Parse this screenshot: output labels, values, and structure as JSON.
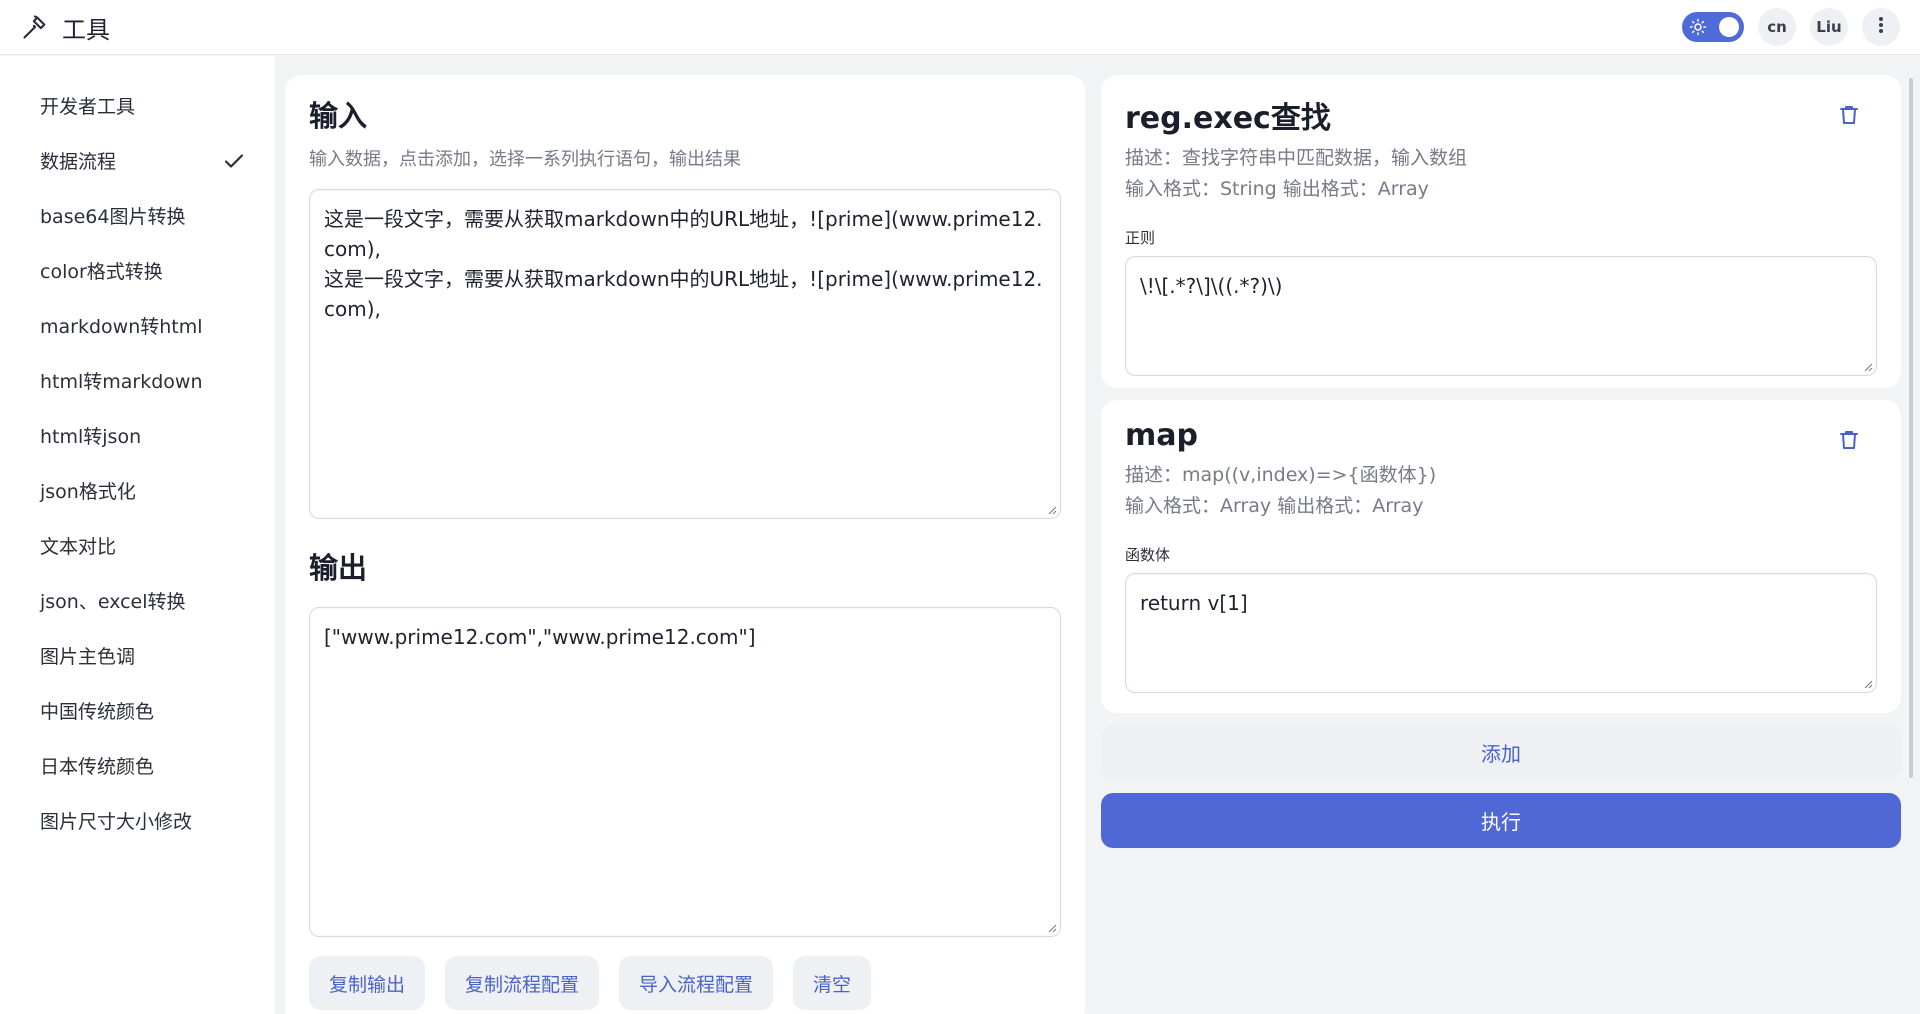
{
  "app": {
    "title": "工具"
  },
  "header": {
    "lang_label": "cn",
    "user_label": "Liu"
  },
  "sidebar": {
    "items": [
      {
        "label": "开发者工具"
      },
      {
        "label": "数据流程"
      },
      {
        "label": "base64图片转换"
      },
      {
        "label": "color格式转换"
      },
      {
        "label": "markdown转html"
      },
      {
        "label": "html转markdown"
      },
      {
        "label": "html转json"
      },
      {
        "label": "json格式化"
      },
      {
        "label": "文本对比"
      },
      {
        "label": "json、excel转换"
      },
      {
        "label": "图片主色调"
      },
      {
        "label": "中国传统颜色"
      },
      {
        "label": "日本传统颜色"
      },
      {
        "label": "图片尺寸大小修改"
      }
    ],
    "selected_index": 1
  },
  "input_section": {
    "title": "输入",
    "description": "输入数据，点击添加，选择一系列执行语句，输出结果",
    "value": "这是一段文字，需要从获取markdown中的URL地址，![prime](www.prime12.com),\n这是一段文字，需要从获取markdown中的URL地址，![prime](www.prime12.com),"
  },
  "output_section": {
    "title": "输出",
    "value": "[\"www.prime12.com\",\"www.prime12.com\"]"
  },
  "action_buttons": {
    "copy_output": "复制输出",
    "copy_config": "复制流程配置",
    "import_config": "导入流程配置",
    "clear": "清空"
  },
  "steps": [
    {
      "title": "reg.exec查找",
      "description": "描述：查找字符串中匹配数据，输入数组",
      "formats": "输入格式：String 输出格式：Array",
      "field_label": "正则",
      "field_value": "\\!\\[.*?\\]\\((.*?)\\)"
    },
    {
      "title": "map",
      "description": "描述：map((v,index)=>{函数体})",
      "formats": "输入格式：Array 输出格式：Array",
      "field_label": "函数体",
      "field_value": "return v[1]"
    }
  ],
  "add_label": "添加",
  "run_label": "执行",
  "colors": {
    "accent": "#5068d6",
    "button_text": "#4a63c8",
    "background": "#f2f3f5"
  }
}
